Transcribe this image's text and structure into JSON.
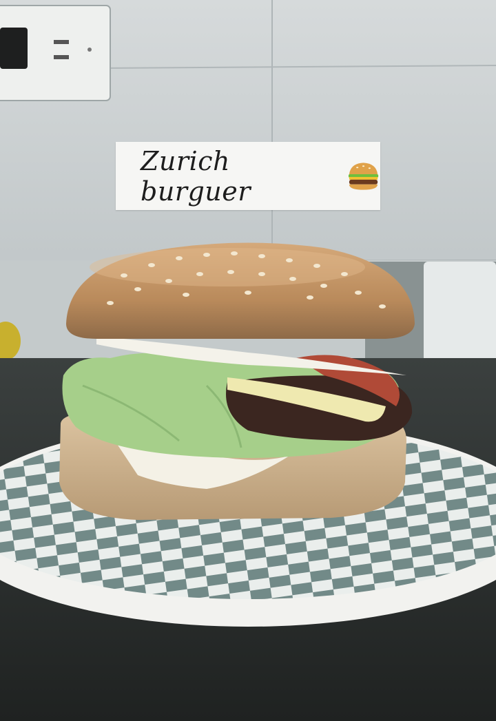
{
  "sticker": {
    "text": "Zurich burguer",
    "emoji_icon": "burger-emoji-icon"
  },
  "colors": {
    "wall": "#c9ced0",
    "bun": "#c79a6a",
    "lettuce": "#a6cf8a",
    "checker_dark": "#5f7a78",
    "plate": "#f2f2ef"
  }
}
